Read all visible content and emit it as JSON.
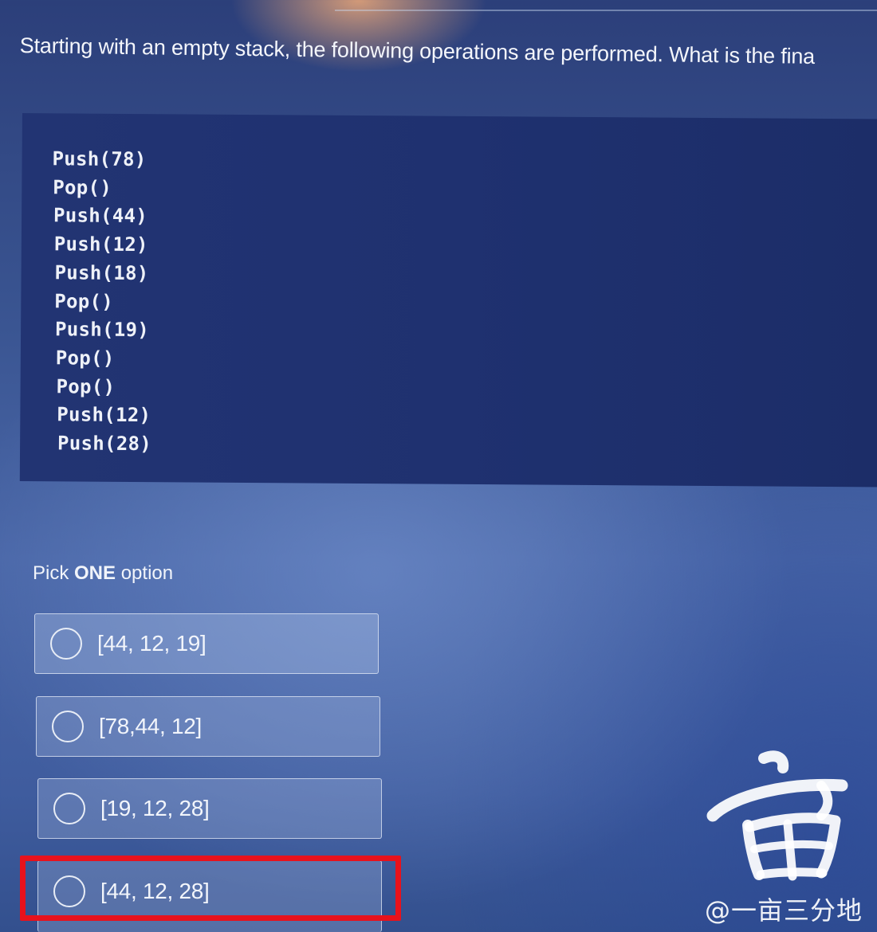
{
  "question": {
    "text": "Starting with an empty stack, the following operations are performed.  What is the fina"
  },
  "code": {
    "lines": [
      "Push(78)",
      "Pop()",
      "Push(44)",
      "Push(12)",
      "Push(18)",
      "Pop()",
      "Push(19)",
      "Pop()",
      "Pop()",
      "Push(12)",
      "Push(28)"
    ]
  },
  "pick": {
    "prefix": "Pick ",
    "emphasis": "ONE",
    "suffix": " option"
  },
  "options": [
    {
      "label": "[44, 12, 19]",
      "selected": false
    },
    {
      "label": "[78,44, 12]",
      "selected": false
    },
    {
      "label": "[19, 12, 28]",
      "selected": false
    },
    {
      "label": "[44, 12, 28]",
      "selected": false,
      "highlighted": true
    }
  ],
  "highlight_color": "#e8121c",
  "watermark": {
    "logo_char": "亩",
    "handle": "@一亩三分地"
  }
}
